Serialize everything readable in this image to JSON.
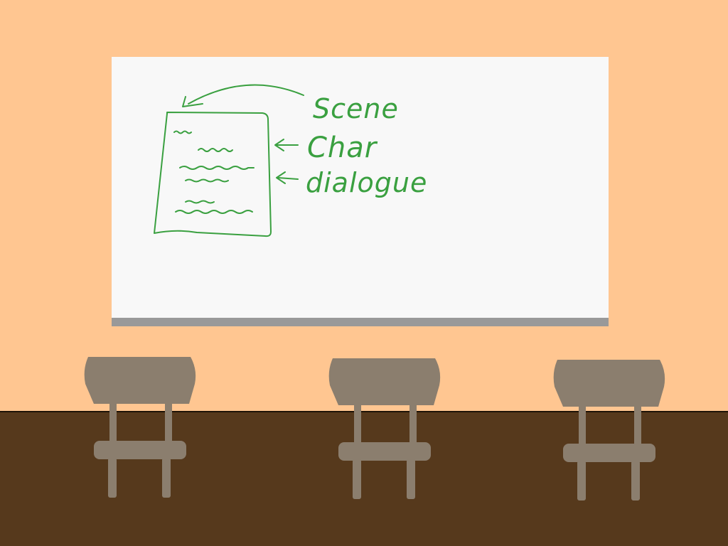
{
  "colors": {
    "wall": "#ffc691",
    "floor": "#56391c",
    "whiteboard": "#f8f8f8",
    "board_tray": "#999999",
    "marker": "#3aa040",
    "chair": "#8b7e6e"
  },
  "whiteboard": {
    "labels": {
      "scene": "Scene",
      "char": "Char",
      "dialogue": "dialogue"
    }
  },
  "chairs": [
    {
      "name": "chair-left"
    },
    {
      "name": "chair-center"
    },
    {
      "name": "chair-right"
    }
  ]
}
